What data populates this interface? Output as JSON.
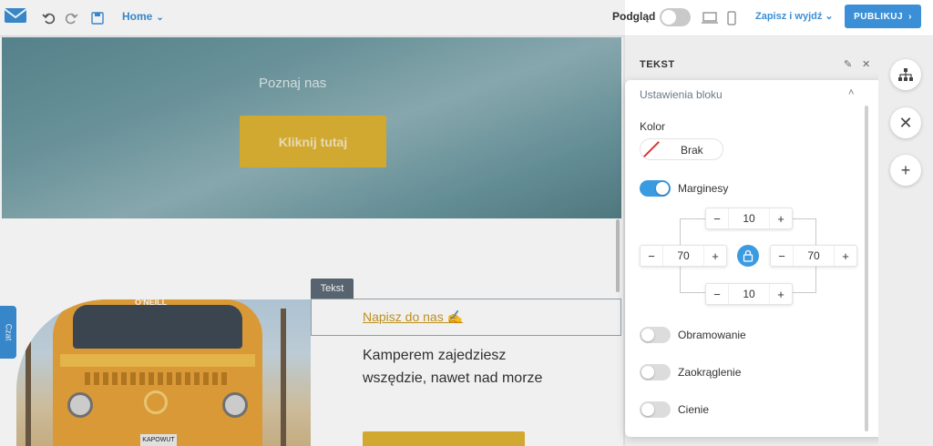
{
  "topbar": {
    "logo_icon": "envelope-logo-icon",
    "undo_icon": "undo-icon",
    "redo_icon": "redo-icon",
    "save_icon": "floppy-icon",
    "page_select": "Home",
    "preview_label": "Podgląd",
    "preview_enabled": false,
    "desktop_icon": "desktop-icon",
    "mobile_icon": "mobile-icon",
    "save_exit_label": "Zapisz i wyjdź",
    "publish_label": "PUBLIKUJ"
  },
  "canvas": {
    "hero_text": "Poznaj nas",
    "hero_button": "Kliknij tutaj",
    "block_label": "Tekst",
    "block_link": "Napisz do nas ✍",
    "block_body": "Kamperem zajedziesz wszędzie, nawet nad morze",
    "van_brand": "O'NEILL",
    "van_plate": "KAPOWUT",
    "chat_tab": "Czat"
  },
  "panel": {
    "title": "TEKST",
    "section": "Ustawienia bloku",
    "color_label": "Kolor",
    "color_value": "Brak",
    "margins_label": "Marginesy",
    "margins_enabled": true,
    "margin_top": "10",
    "margin_left": "70",
    "margin_right": "70",
    "margin_bottom": "10",
    "border_label": "Obramowanie",
    "border_enabled": false,
    "radius_label": "Zaokrąglenie",
    "radius_enabled": false,
    "shadow_label": "Cienie",
    "shadow_enabled": false
  },
  "right_toolbar": {
    "items": [
      "sitemap-icon",
      "close-icon",
      "plus-icon"
    ]
  },
  "colors": {
    "accent": "#3b8fd6",
    "button_gold": "#e0b434",
    "toggle_on": "#3b9be0"
  }
}
